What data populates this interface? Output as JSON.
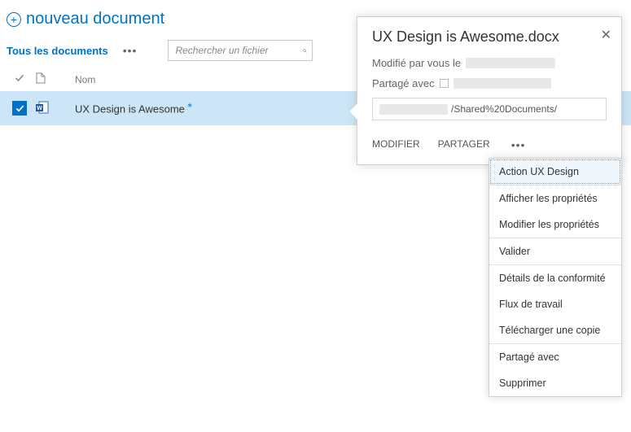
{
  "header": {
    "new_document": "nouveau document"
  },
  "toolbar": {
    "view": "Tous les documents",
    "search_placeholder": "Rechercher un fichier"
  },
  "columns": {
    "name": "Nom"
  },
  "row": {
    "filename": "UX Design is Awesome"
  },
  "callout": {
    "title": "UX Design is Awesome.docx",
    "modified_label": "Modifié par vous le",
    "shared_label": "Partagé avec",
    "url_suffix": "/Shared%20Documents/",
    "edit": "MODIFIER",
    "share": "PARTAGER"
  },
  "menu": {
    "items": [
      "Action UX Design",
      "Afficher les propriétés",
      "Modifier les propriétés",
      "Valider",
      "Détails de la conformité",
      "Flux de travail",
      "Télécharger une copie",
      "Partagé avec",
      "Supprimer"
    ]
  }
}
